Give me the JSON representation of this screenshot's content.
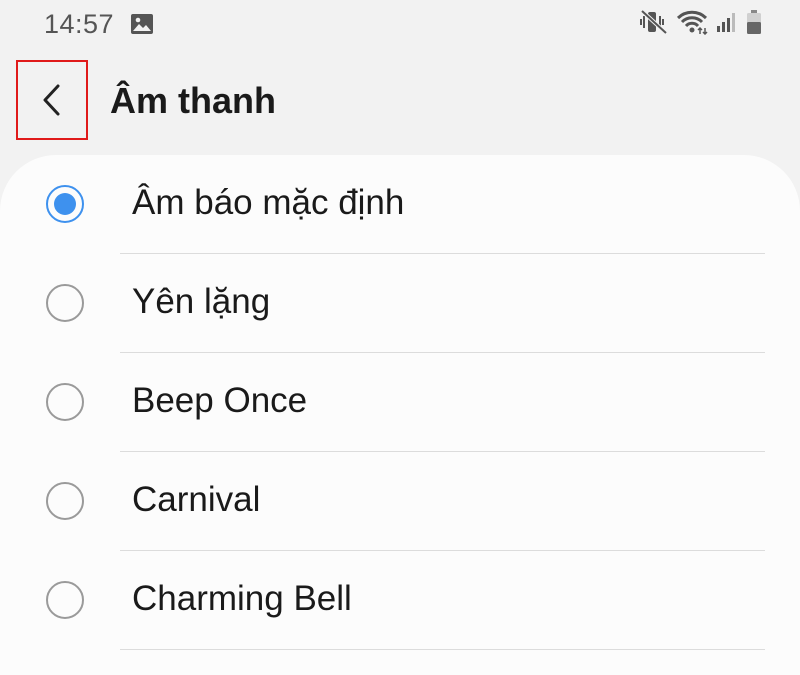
{
  "status_bar": {
    "time": "14:57",
    "icons": [
      "gallery-icon",
      "mute-vibrate-icon",
      "wifi-icon",
      "signal-icon",
      "battery-icon"
    ]
  },
  "header": {
    "back_icon": "chevron-left-icon",
    "title": "Âm thanh"
  },
  "sound_list": {
    "items": [
      {
        "label": "Âm báo mặc định",
        "selected": true
      },
      {
        "label": "Yên lặng",
        "selected": false
      },
      {
        "label": "Beep Once",
        "selected": false
      },
      {
        "label": "Carnival",
        "selected": false
      },
      {
        "label": "Charming Bell",
        "selected": false
      }
    ]
  },
  "colors": {
    "accent": "#3e91ee",
    "highlight_box": "#e01a1a",
    "background": "#f2f2f2",
    "card": "#fcfcfc"
  }
}
